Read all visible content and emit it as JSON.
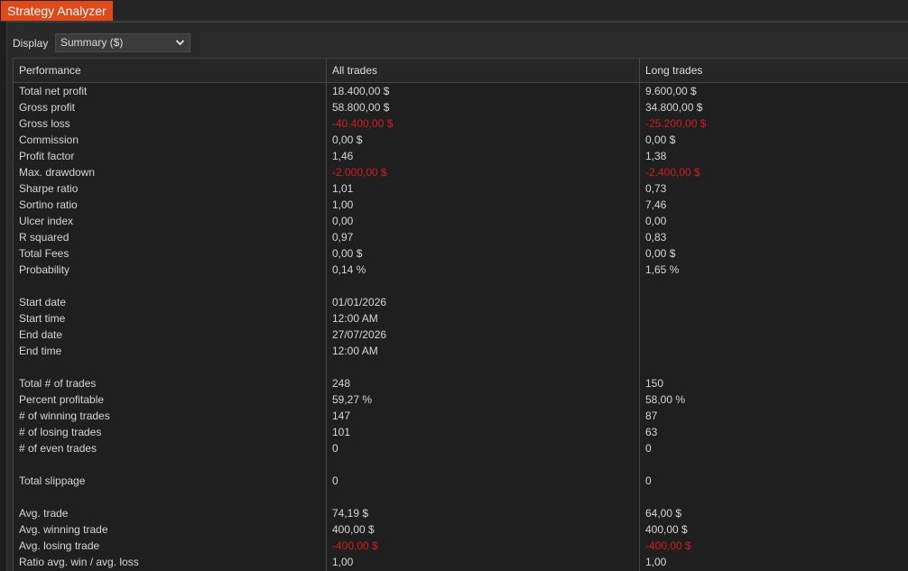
{
  "window": {
    "title": "Strategy Analyzer"
  },
  "display": {
    "label": "Display",
    "selected": "Summary ($)"
  },
  "table": {
    "columns": [
      "Performance",
      "All trades",
      "Long trades"
    ],
    "rows": [
      {
        "label": "Total net profit",
        "all": "18.400,00 $",
        "long": "9.600,00 $",
        "all_neg": false,
        "long_neg": false
      },
      {
        "label": "Gross profit",
        "all": "58.800,00 $",
        "long": "34.800,00 $",
        "all_neg": false,
        "long_neg": false
      },
      {
        "label": "Gross loss",
        "all": "-40.400,00 $",
        "long": "-25.200,00 $",
        "all_neg": true,
        "long_neg": true
      },
      {
        "label": "Commission",
        "all": "0,00 $",
        "long": "0,00 $",
        "all_neg": false,
        "long_neg": false
      },
      {
        "label": "Profit factor",
        "all": "1,46",
        "long": "1,38",
        "all_neg": false,
        "long_neg": false
      },
      {
        "label": "Max. drawdown",
        "all": "-2.000,00 $",
        "long": "-2.400,00 $",
        "all_neg": true,
        "long_neg": true
      },
      {
        "label": "Sharpe ratio",
        "all": "1,01",
        "long": "0,73",
        "all_neg": false,
        "long_neg": false
      },
      {
        "label": "Sortino ratio",
        "all": "1,00",
        "long": "7,46",
        "all_neg": false,
        "long_neg": false
      },
      {
        "label": "Ulcer index",
        "all": "0,00",
        "long": "0,00",
        "all_neg": false,
        "long_neg": false
      },
      {
        "label": "R squared",
        "all": "0,97",
        "long": "0,83",
        "all_neg": false,
        "long_neg": false
      },
      {
        "label": "Total Fees",
        "all": "0,00 $",
        "long": "0,00 $",
        "all_neg": false,
        "long_neg": false
      },
      {
        "label": "Probability",
        "all": "0,14 %",
        "long": "1,65 %",
        "all_neg": false,
        "long_neg": false
      },
      {
        "label": "",
        "all": "",
        "long": "",
        "all_neg": false,
        "long_neg": false
      },
      {
        "label": "Start date",
        "all": "01/01/2026",
        "long": "",
        "all_neg": false,
        "long_neg": false
      },
      {
        "label": "Start time",
        "all": "12:00 AM",
        "long": "",
        "all_neg": false,
        "long_neg": false
      },
      {
        "label": "End date",
        "all": "27/07/2026",
        "long": "",
        "all_neg": false,
        "long_neg": false
      },
      {
        "label": "End time",
        "all": "12:00 AM",
        "long": "",
        "all_neg": false,
        "long_neg": false
      },
      {
        "label": "",
        "all": "",
        "long": "",
        "all_neg": false,
        "long_neg": false
      },
      {
        "label": "Total # of trades",
        "all": "248",
        "long": "150",
        "all_neg": false,
        "long_neg": false
      },
      {
        "label": "Percent profitable",
        "all": "59,27 %",
        "long": "58,00 %",
        "all_neg": false,
        "long_neg": false
      },
      {
        "label": "# of winning trades",
        "all": "147",
        "long": "87",
        "all_neg": false,
        "long_neg": false
      },
      {
        "label": "# of losing trades",
        "all": "101",
        "long": "63",
        "all_neg": false,
        "long_neg": false
      },
      {
        "label": "# of even trades",
        "all": "0",
        "long": "0",
        "all_neg": false,
        "long_neg": false
      },
      {
        "label": "",
        "all": "",
        "long": "",
        "all_neg": false,
        "long_neg": false
      },
      {
        "label": "Total slippage",
        "all": "0",
        "long": "0",
        "all_neg": false,
        "long_neg": false
      },
      {
        "label": "",
        "all": "",
        "long": "",
        "all_neg": false,
        "long_neg": false
      },
      {
        "label": "Avg. trade",
        "all": "74,19 $",
        "long": "64,00 $",
        "all_neg": false,
        "long_neg": false
      },
      {
        "label": "Avg. winning trade",
        "all": "400,00 $",
        "long": "400,00 $",
        "all_neg": false,
        "long_neg": false
      },
      {
        "label": "Avg. losing trade",
        "all": "-400,00 $",
        "long": "-400,00 $",
        "all_neg": true,
        "long_neg": true
      },
      {
        "label": "Ratio avg. win / avg. loss",
        "all": "1,00",
        "long": "1,00",
        "all_neg": false,
        "long_neg": false
      }
    ]
  },
  "colors": {
    "accent": "#e04a1a",
    "negative": "#d21d1d",
    "background": "#1e1e1e"
  }
}
